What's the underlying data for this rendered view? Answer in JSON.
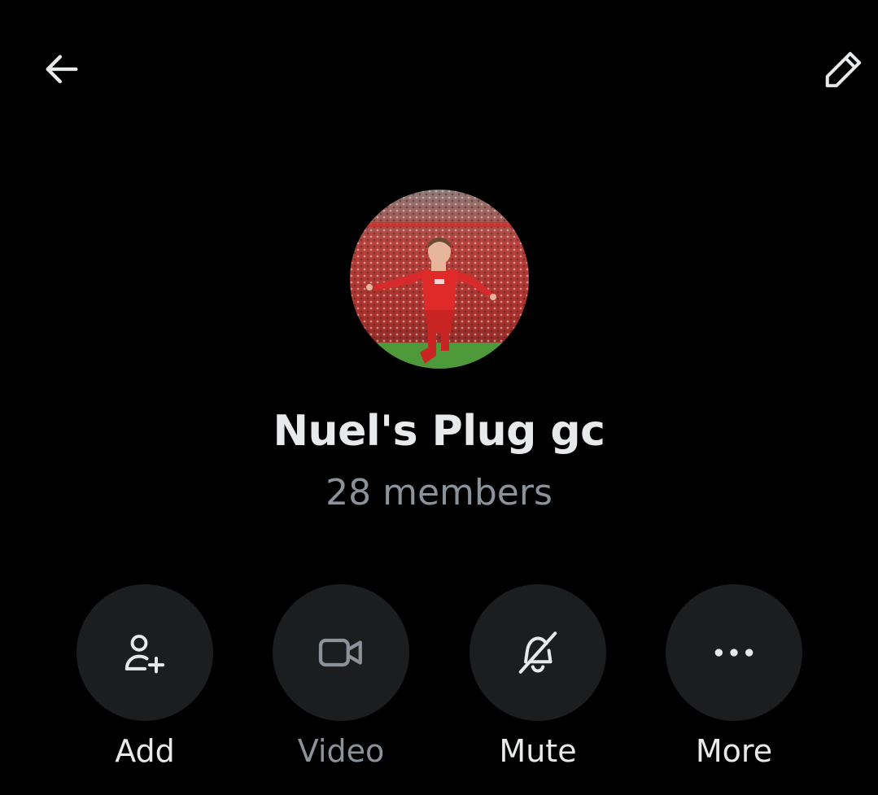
{
  "header": {
    "back_icon": "arrow-left-icon",
    "edit_icon": "pencil-icon"
  },
  "group": {
    "name": "Nuel's Plug gc",
    "members": "28 members",
    "avatar_description_icon": "group-avatar"
  },
  "actions": [
    {
      "label": "Add",
      "icon": "add-person-icon",
      "enabled": true
    },
    {
      "label": "Video",
      "icon": "video-camera-icon",
      "enabled": false
    },
    {
      "label": "Mute",
      "icon": "bell-off-icon",
      "enabled": true
    },
    {
      "label": "More",
      "icon": "more-dots-icon",
      "enabled": true
    }
  ],
  "colors": {
    "background": "#000000",
    "primary_text": "#e7e9ea",
    "secondary_text": "#8b9299",
    "button_bg": "#1c1d1f"
  }
}
